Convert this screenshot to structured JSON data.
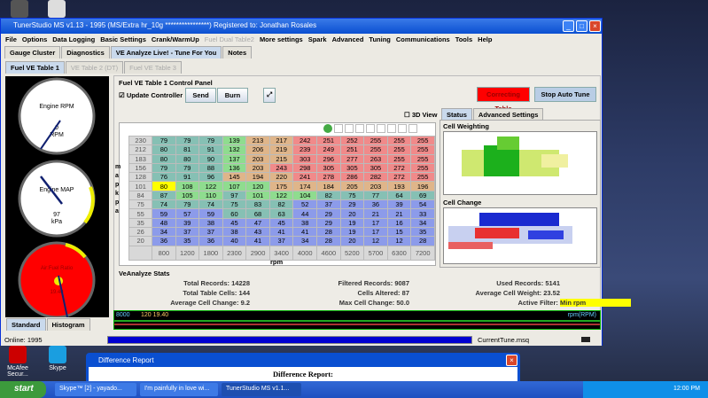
{
  "desktop": {
    "icons": [
      {
        "label": "McAfee Secur..."
      },
      {
        "label": "Skype"
      }
    ]
  },
  "window": {
    "title": "TunerStudio MS v1.13 - 1995 (MS/Extra hr_10g ****************) Registered to: Jonathan Rosales",
    "menu": [
      "File",
      "Options",
      "Data Logging",
      "Basic Settings",
      "Crank/WarmUp",
      "Fuel Dual Table2",
      "More settings",
      "Spark",
      "Advanced",
      "Tuning",
      "Communications",
      "Tools",
      "Help"
    ],
    "main_tabs": [
      "Gauge Cluster",
      "Diagnostics",
      "VE Analyze Live! - Tune For You",
      "Notes"
    ],
    "sub_tabs": [
      "Fuel VE Table 1",
      "VE Table 2 (DT)",
      "Fuel VE Table 3"
    ]
  },
  "gauges": [
    {
      "title": "Engine RPM",
      "unit": "RPM",
      "value": "0",
      "scale": "x1000",
      "ticks": [
        "0",
        "1",
        "2",
        "3",
        "4",
        "5",
        "6",
        "7",
        "8"
      ]
    },
    {
      "title": "Engine MAP",
      "unit": "kPa",
      "value": "97",
      "ticks": [
        "0",
        "20",
        "40",
        "60",
        "80",
        "100",
        "120",
        "140",
        "160",
        "180",
        "200",
        "220",
        "240"
      ]
    },
    {
      "title": "Air:Fuel Ratio",
      "value": "19.40"
    }
  ],
  "gauge_tabs": [
    "Standard",
    "Histogram"
  ],
  "control": {
    "title": "Fuel VE Table 1 Control Panel",
    "update_controller": "Update Controller",
    "send": "Send",
    "burn": "Burn",
    "correcting": "Correcting Table",
    "stop": "Stop Auto Tune",
    "view3d": "3D View"
  },
  "table": {
    "y_label": "m a p   k p a",
    "x_label": "rpm",
    "map": [
      "230",
      "212",
      "183",
      "156",
      "128",
      "101",
      "84",
      "75",
      "55",
      "35",
      "26",
      "20"
    ],
    "rpm": [
      "800",
      "1200",
      "1800",
      "2300",
      "2900",
      "3400",
      "4000",
      "4600",
      "5200",
      "5700",
      "6300",
      "7200"
    ],
    "rows": [
      [
        79,
        79,
        79,
        139,
        213,
        217,
        242,
        251,
        252,
        255,
        255,
        255
      ],
      [
        80,
        81,
        91,
        132,
        206,
        219,
        239,
        249,
        251,
        255,
        255,
        255
      ],
      [
        80,
        80,
        90,
        137,
        203,
        215,
        303,
        296,
        277,
        263,
        255,
        255
      ],
      [
        79,
        79,
        88,
        136,
        203,
        243,
        298,
        305,
        305,
        305,
        272,
        255
      ],
      [
        76,
        91,
        96,
        145,
        194,
        220,
        241,
        278,
        286,
        282,
        272,
        255
      ],
      [
        80,
        108,
        122,
        107,
        120,
        175,
        174,
        184,
        205,
        203,
        193,
        196
      ],
      [
        87,
        105,
        110,
        97,
        101,
        122,
        104,
        82,
        75,
        77,
        64,
        69
      ],
      [
        74,
        79,
        74,
        75,
        83,
        82,
        52,
        37,
        29,
        36,
        39,
        54
      ],
      [
        59,
        57,
        59,
        60,
        68,
        63,
        44,
        29,
        20,
        21,
        21,
        33
      ],
      [
        48,
        39,
        38,
        45,
        47,
        45,
        38,
        29,
        19,
        17,
        16,
        34
      ],
      [
        34,
        37,
        37,
        38,
        43,
        41,
        41,
        28,
        19,
        17,
        15,
        35
      ],
      [
        36,
        35,
        36,
        40,
        41,
        37,
        34,
        28,
        20,
        12,
        12,
        28
      ]
    ]
  },
  "right": {
    "tabs": [
      "Status",
      "Advanced Settings"
    ],
    "cell_weighting": "Cell Weighting",
    "cell_change": "Cell Change"
  },
  "stats": {
    "title": "VeAnalyze Stats",
    "items": [
      {
        "label": "Total Records:",
        "value": "14228"
      },
      {
        "label": "Filtered Records:",
        "value": "9087"
      },
      {
        "label": "Used Records:",
        "value": "5141"
      },
      {
        "label": "Total Table Cells:",
        "value": "144"
      },
      {
        "label": "Cells Altered:",
        "value": "87"
      },
      {
        "label": "Average Cell Weight:",
        "value": "23.52"
      },
      {
        "label": "Average Cell Change:",
        "value": "9.2"
      },
      {
        "label": "Max Cell Change:",
        "value": "50.0"
      },
      {
        "label": "Active Filter:",
        "value": "Min rpm"
      }
    ]
  },
  "graph": {
    "readout": "8000",
    "readout2": "120 19.40",
    "legend": "rpm(RPM)"
  },
  "statusbar": {
    "online": "Online: 1995",
    "file": "CurrentTune.msq",
    "progress": 1.0
  },
  "dialog": {
    "title": "Difference Report",
    "heading": "Difference Report:"
  },
  "taskbar": {
    "start": "start",
    "tasks": [
      "Skype™ [2] - yayado...",
      "I'm painfully in love wi...",
      "TunerStudio MS v1.1..."
    ],
    "clock": "12:00 PM"
  }
}
